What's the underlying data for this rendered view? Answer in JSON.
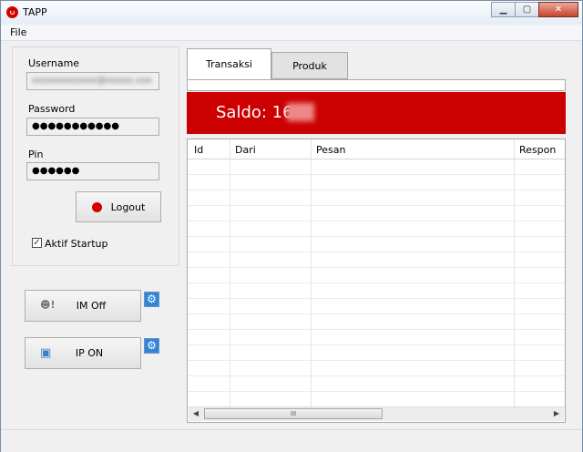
{
  "window": {
    "title": "TAPP"
  },
  "menu": {
    "file": "File"
  },
  "login": {
    "username_label": "Username",
    "password_label": "Password",
    "password_value": "●●●●●●●●●●●",
    "pin_label": "Pin",
    "pin_value": "●●●●●●",
    "logout_label": "Logout",
    "startup_label": "Aktif Startup",
    "startup_checked": "✓"
  },
  "services": {
    "im_label": "IM Off",
    "ip_label": "IP ON"
  },
  "tabs": {
    "transaksi": "Transaksi",
    "produk": "Produk"
  },
  "saldo": {
    "label": "Saldo: 16"
  },
  "table": {
    "columns": [
      "Id",
      "Dari",
      "Pesan",
      "Respon"
    ]
  },
  "scrollbar": {
    "left": "◀",
    "right": "▶",
    "grip": "III"
  },
  "colors": {
    "accent": "#cc0000"
  }
}
